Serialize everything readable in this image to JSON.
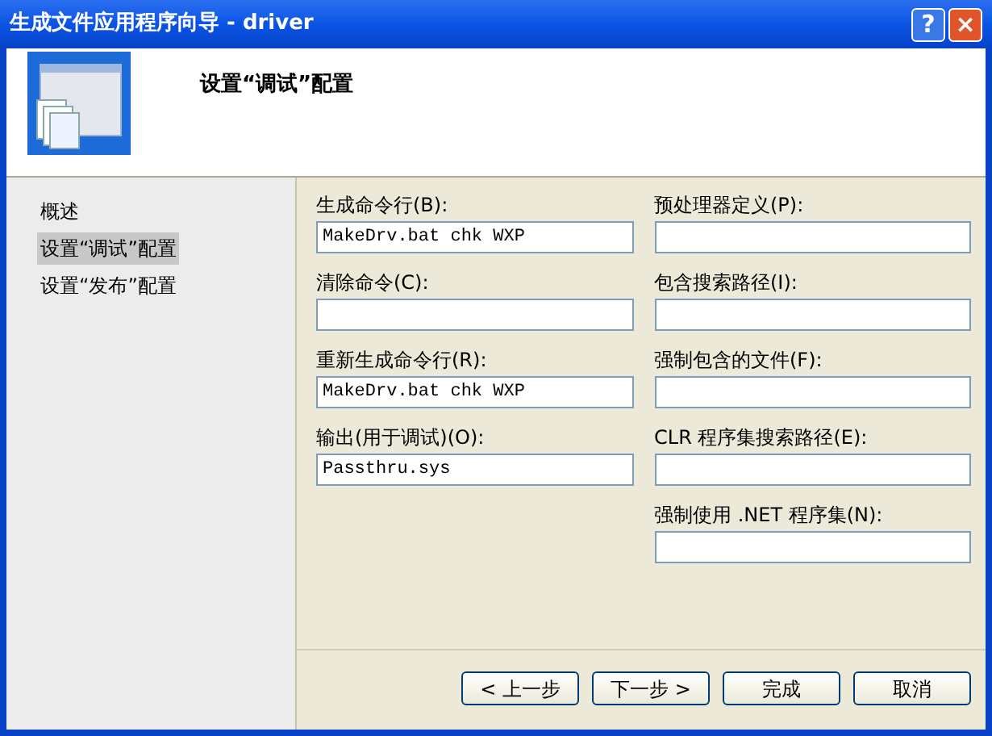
{
  "window": {
    "title": "生成文件应用程序向导 - driver",
    "buttons": [
      {
        "kind": "help",
        "label": "?"
      },
      {
        "kind": "close",
        "label": "×"
      }
    ]
  },
  "header": {
    "title": "设置“调试”配置"
  },
  "sidebar": {
    "items": [
      {
        "label": "概述",
        "selected": false
      },
      {
        "label": "设置“调试”配置",
        "selected": true
      },
      {
        "label": "设置“发布”配置",
        "selected": false
      }
    ]
  },
  "left_fields": [
    {
      "label": "生成命令行(B):",
      "value": "MakeDrv.bat chk WXP"
    },
    {
      "label": "清除命令(C):"
    },
    {
      "label": "重新生成命令行(R):",
      "value": "MakeDrv.bat chk WXP"
    },
    {
      "label": "输出(用于调试)(O):",
      "value": "Passthru.sys"
    }
  ],
  "right_fields": [
    {
      "label": "预处理器定义(P):"
    },
    {
      "label": "包含搜索路径(I):"
    },
    {
      "label": "强制包含的文件(F):"
    },
    {
      "label": "CLR 程序集搜索路径(E):"
    },
    {
      "label": "强制使用 .NET 程序集(N):"
    }
  ],
  "buttons": [
    "< 上一步",
    "下一步 >",
    "完成",
    "取消"
  ]
}
